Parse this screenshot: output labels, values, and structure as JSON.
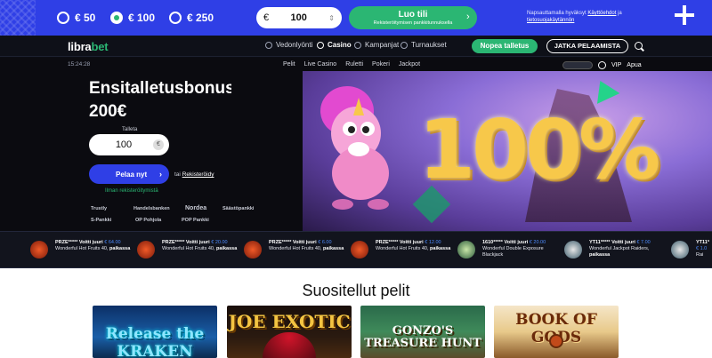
{
  "topbar": {
    "amounts": [
      {
        "label": "€ 50",
        "selected": false
      },
      {
        "label": "€ 100",
        "selected": true
      },
      {
        "label": "€ 250",
        "selected": false
      }
    ],
    "amount_input_value": "100",
    "amount_input_currency": "€",
    "cta_title": "Luo tili",
    "cta_subtitle": "Rekisteröitymisen pankkitunnuksella",
    "terms_text": "Napsauttamalla hyväksyt",
    "terms_link1": "Käyttöehdot",
    "terms_mid": "ja",
    "terms_link2": "tietosuojakäytännön"
  },
  "nav": {
    "logo_main": "libra",
    "logo_accent": "bet",
    "items": [
      {
        "label": "Vedonlyönti",
        "icon": "sports-icon",
        "active": false
      },
      {
        "label": "Casino",
        "icon": "casino-icon",
        "active": true
      },
      {
        "label": "Kampanjat",
        "icon": "promo-icon",
        "active": false
      },
      {
        "label": "Turnaukset",
        "icon": "trophy-icon",
        "active": false
      }
    ],
    "deposit_button": "Nopea talletus",
    "continue_button": "JATKA PELAAMISTA"
  },
  "hero": {
    "clock": "15:24:28",
    "tabs": [
      "Pelit",
      "Live Casino",
      "Ruletti",
      "Pokeri",
      "Jackpot"
    ],
    "vip": "VIP",
    "help": "Apua",
    "title_line1": "Ensitalletusbonus",
    "title_line2": "200€",
    "art_text": "100%",
    "field_label": "Talleta",
    "field_value": "100",
    "field_currency": "€",
    "play_button": "Pelaa nyt",
    "play_arrow": "›",
    "reg_prefix": "tai",
    "reg_link": "Rekisteröidy",
    "no_reg": "Ilman rekisteröitymistä",
    "banks_row1": [
      "Trustly",
      "Handelsbanken",
      "Nordea",
      "Säästöpankki"
    ],
    "banks_row2": [
      "S-Pankki",
      "OP Pohjola",
      "POP Pankki"
    ]
  },
  "ticker": [
    {
      "user": "PRZE*****",
      "action": "Voitti juuri",
      "amount": "€ 64.00",
      "game": "Wonderful Hot Fruits 40,",
      "where": "paikassa",
      "thumb": "fire"
    },
    {
      "user": "PRZE*****",
      "action": "Voitti juuri",
      "amount": "€ 20.00",
      "game": "Wonderful Hot Fruits 40,",
      "where": "paikassa",
      "thumb": "fire"
    },
    {
      "user": "PRZE*****",
      "action": "Voitti juuri",
      "amount": "€ 6.00",
      "game": "Wonderful Hot Fruits 40,",
      "where": "paikassa",
      "thumb": "fire"
    },
    {
      "user": "PRZE*****",
      "action": "Voitti juuri",
      "amount": "€ 12.00",
      "game": "Wonderful Hot Fruits 40,",
      "where": "paikassa",
      "thumb": "fire"
    },
    {
      "user": "1610*****",
      "action": "Voitti juuri",
      "amount": "€ 20.00",
      "game": "Wonderful Double Exposure Blackjack",
      "where": "",
      "thumb": "alt"
    },
    {
      "user": "YT11*****",
      "action": "Voitti juuri",
      "amount": "€ 7.00",
      "game": "Wonderful Jackpot Raiders,",
      "where": "paikassa",
      "thumb": "alt2"
    },
    {
      "user": "YT11*",
      "action": "",
      "amount": "€ 1.0",
      "game": "Rai",
      "where": "",
      "thumb": "alt2"
    }
  ],
  "games": {
    "title": "Suositellut pelit",
    "cards": [
      {
        "name": "Release the KRAKEN"
      },
      {
        "name": "JOE EXOTIC"
      },
      {
        "name": "GONZO'S TREASURE HUNT"
      },
      {
        "name": "BOOK OF GODS"
      }
    ]
  },
  "colors": {
    "brand_blue": "#2f3fe6",
    "brand_green": "#2bb673",
    "gold": "#f7c84a"
  }
}
